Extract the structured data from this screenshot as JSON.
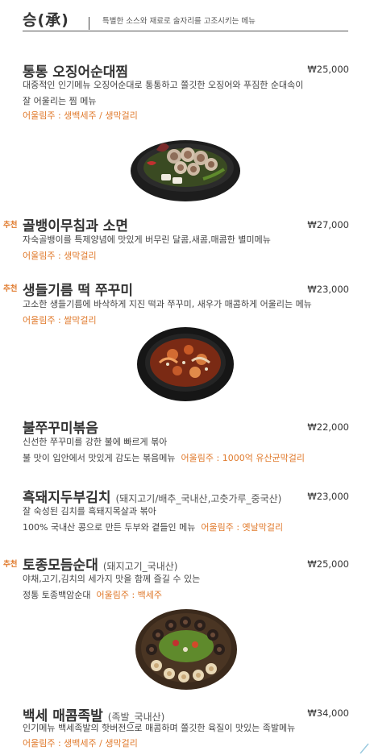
{
  "header": {
    "title": "승(承)",
    "subtitle": "특별한 소스와 재료로 술자리를 고조시키는 메뉴"
  },
  "items": [
    {
      "name": "통통 오징어순대찜",
      "price": "₩25,000",
      "desc1": "대중적인 인기메뉴 오징어순대로 통통하고 쫄깃한 오징어와 푸짐한 순대속이",
      "desc2": "잘 어울리는 찜 메뉴",
      "pairing": "어울림주 : 생백세주 / 생막걸리"
    },
    {
      "badge": "추천",
      "name": "골뱅이무침과 소면",
      "price": "₩27,000",
      "desc1": "자숙골뱅이를 특제양념에 맛있게 버무린 달콤,새콤,매콤한 별미메뉴",
      "pairing": "어울림주 : 생막걸리"
    },
    {
      "badge": "추천",
      "name": "생들기름 떡 쭈꾸미",
      "price": "₩23,000",
      "desc1": "고소한 생들기름에 바삭하게 지진 떡과 쭈꾸미, 새우가 매콤하게 어울리는 메뉴",
      "pairing": "어울림주 : 쌀막걸리"
    },
    {
      "name": "불쭈꾸미볶음",
      "price": "₩22,000",
      "desc1": "신선한 쭈꾸미를 강한 불에 빠르게 볶아",
      "desc2": "불 맛이 입안에서 맛있게 감도는 볶음메뉴",
      "pairing": "어울림주 : 1000억 유산균막걸리"
    },
    {
      "name": "흑돼지두부김치",
      "note": "(돼지고기/배추_국내산,고춧가루_중국산)",
      "price": "₩23,000",
      "desc1": "잘 숙성된 김치를 흑돼지목살과 볶아",
      "desc2": "100% 국내산 콩으로 만든 두부와 곁들인 메뉴",
      "pairing": "어울림주 : 옛날막걸리"
    },
    {
      "badge": "추천",
      "name": "토종모듬순대",
      "note": "(돼지고기_국내산)",
      "price": "₩25,000",
      "desc1": "야채,고기,김치의 세가지 맛을 함께 즐길 수 있는",
      "desc2": "정통 토종백암순대",
      "pairing": "어울림주 : 백세주"
    },
    {
      "name": "백세 매콤족발",
      "note": "(족발_국내산)",
      "price": "₩34,000",
      "desc1": "인기메뉴 백세족발의 핫버전으로 매콤하며 쫄깃한 육질이 맛있는 족발메뉴",
      "pairing": "어울림주 : 생백세주 / 생막걸리"
    }
  ],
  "images": {
    "dish1": "squid-sundae-steamed-dish",
    "dish2": "webfoot-octopus-rice-cake-dish",
    "dish3": "assorted-sundae-platter"
  },
  "colors": {
    "accent": "#e07a2c",
    "text": "#3a3a3a"
  }
}
